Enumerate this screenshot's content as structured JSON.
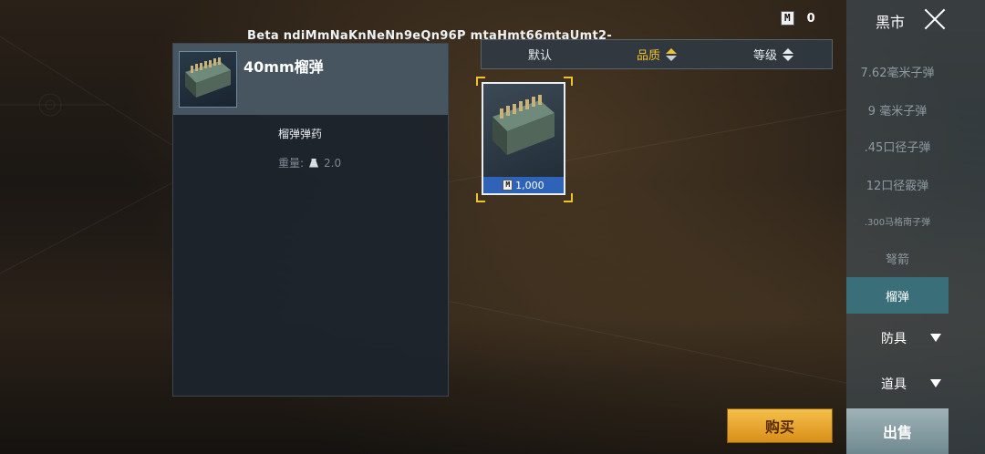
{
  "beta_text": "Beta ndiMmNaKnNeNn9eQn96P mtaHmt66mtaUmt2-",
  "currency": {
    "icon_label": "M",
    "amount": "0"
  },
  "detail": {
    "title": "40mm榴弹",
    "type": "榴弹弹药",
    "weight_label": "重量:",
    "weight_value": "2.0"
  },
  "sort": {
    "options": [
      {
        "label": "默认"
      },
      {
        "label": "品质"
      },
      {
        "label": "等级"
      }
    ]
  },
  "item_card": {
    "price_icon": "M",
    "price": "1,000"
  },
  "sidebar": {
    "title": "黑市",
    "items": [
      {
        "label": "7.62毫米子弹"
      },
      {
        "label": "9 毫米子弹"
      },
      {
        "label": ".45口径子弹"
      },
      {
        "label": "12口径霰弹"
      },
      {
        "label": ".300马格南子弹"
      },
      {
        "label": "弩箭"
      },
      {
        "label": "榴弹"
      }
    ],
    "categories": [
      {
        "label": "防具"
      },
      {
        "label": "道具"
      }
    ],
    "sell_label": "出售"
  },
  "buy_label": "购买",
  "colors": {
    "accent": "#f2c12e",
    "price_bar": "#2f63b8",
    "active_tab": "#3a6f7a"
  }
}
